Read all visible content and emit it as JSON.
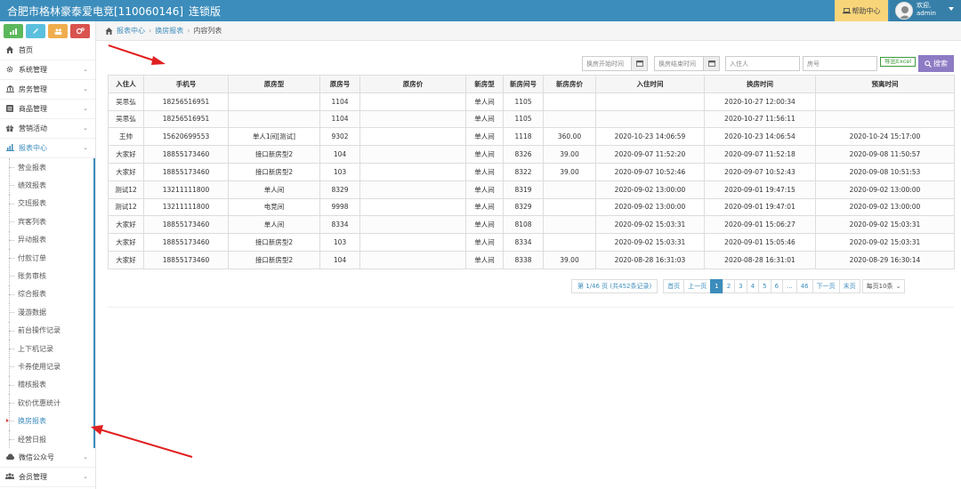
{
  "header": {
    "title": "合肥市格林豪泰爱电竞[110060146]",
    "edition": "连锁版",
    "help_label": "帮助中心",
    "welcome": "欢迎,",
    "username": "admin"
  },
  "quick_buttons": [
    {
      "icon": "bar-chart-icon",
      "color": "#5cb85c"
    },
    {
      "icon": "pencil-icon",
      "color": "#5bc0de"
    },
    {
      "icon": "users-icon",
      "color": "#f0ad4e"
    },
    {
      "icon": "cogs-icon",
      "color": "#d9534f"
    }
  ],
  "sidebar": {
    "items": [
      {
        "label": "首页",
        "icon": "home-icon"
      },
      {
        "label": "系统管理",
        "icon": "gear-icon"
      },
      {
        "label": "房务管理",
        "icon": "bank-icon"
      },
      {
        "label": "商品管理",
        "icon": "list-icon"
      },
      {
        "label": "营销活动",
        "icon": "gift-icon"
      },
      {
        "label": "报表中心",
        "icon": "bar-chart-icon"
      }
    ],
    "submenu": [
      "营业报表",
      "绩效报表",
      "交班报表",
      "宾客列表",
      "异动报表",
      "付款订单",
      "账务审核",
      "综合报表",
      "漫游数据",
      "前台操作记录",
      "上下机记录",
      "卡券使用记录",
      "稽核报表",
      "砍价优惠统计",
      "换房报表",
      "经营日报"
    ],
    "active_sub": "换房报表",
    "bottom_items": [
      {
        "label": "微信公众号",
        "icon": "cloud-icon"
      },
      {
        "label": "会员管理",
        "icon": "group-icon"
      }
    ]
  },
  "breadcrumb": {
    "home": "报表中心",
    "section": "换房报表",
    "current": "内容列表"
  },
  "filters": {
    "start_placeholder": "换房开始时间",
    "end_placeholder": "换房结束时间",
    "guest_placeholder": "入住人",
    "room_placeholder": "房号",
    "excel_label": "导出Excel",
    "search_label": "搜索"
  },
  "table": {
    "columns": [
      "入住人",
      "手机号",
      "原房型",
      "原房号",
      "原房价",
      "新房型",
      "新房间号",
      "新房房价",
      "入住时间",
      "换房时间",
      "预离时间"
    ],
    "rows": [
      [
        "吴思弘",
        "18256516951",
        "",
        "1104",
        "",
        "单人间",
        "1105",
        "",
        "",
        "2020-10-27 12:00:34",
        ""
      ],
      [
        "吴思弘",
        "18256516951",
        "",
        "1104",
        "",
        "单人间",
        "1105",
        "",
        "",
        "2020-10-27 11:56:11",
        ""
      ],
      [
        "王帅",
        "15620699553",
        "单人1间[测试]",
        "9302",
        "",
        "单人间",
        "1118",
        "360.00",
        "2020-10-23 14:06:59",
        "2020-10-23 14:06:54",
        "2020-10-24 15:17:00"
      ],
      [
        "大家好",
        "18855173460",
        "接口新房型2",
        "104",
        "",
        "单人间",
        "8326",
        "39.00",
        "2020-09-07 11:52:20",
        "2020-09-07 11:52:18",
        "2020-09-08 11:50:57"
      ],
      [
        "大家好",
        "18855173460",
        "接口新房型2",
        "103",
        "",
        "单人间",
        "8322",
        "39.00",
        "2020-09-07 10:52:46",
        "2020-09-07 10:52:43",
        "2020-09-08 10:51:53"
      ],
      [
        "测试12",
        "13211111800",
        "单人间",
        "8329",
        "",
        "单人间",
        "8319",
        "",
        "2020-09-02 13:00:00",
        "2020-09-01 19:47:15",
        "2020-09-02 13:00:00"
      ],
      [
        "测试12",
        "13211111800",
        "电竞间",
        "9998",
        "",
        "单人间",
        "8329",
        "",
        "2020-09-02 13:00:00",
        "2020-09-01 19:47:01",
        "2020-09-02 13:00:00"
      ],
      [
        "大家好",
        "18855173460",
        "单人间",
        "8334",
        "",
        "单人间",
        "8108",
        "",
        "2020-09-02 15:03:31",
        "2020-09-01 15:06:27",
        "2020-09-02 15:03:31"
      ],
      [
        "大家好",
        "18855173460",
        "接口新房型2",
        "103",
        "",
        "单人间",
        "8334",
        "",
        "2020-09-02 15:03:31",
        "2020-09-01 15:05:46",
        "2020-09-02 15:03:31"
      ],
      [
        "大家好",
        "18855173460",
        "接口新房型2",
        "104",
        "",
        "单人间",
        "8338",
        "39.00",
        "2020-08-28 16:31:03",
        "2020-08-28 16:31:01",
        "2020-08-29 16:30:14"
      ]
    ]
  },
  "pagination": {
    "info": "第 1/46 页 (共452条记录)",
    "first": "首页",
    "prev": "上一页",
    "pages": [
      "1",
      "2",
      "3",
      "4",
      "5",
      "6",
      "...",
      "46"
    ],
    "current": "1",
    "next": "下一页",
    "last": "末页",
    "page_size": "每页10条"
  }
}
